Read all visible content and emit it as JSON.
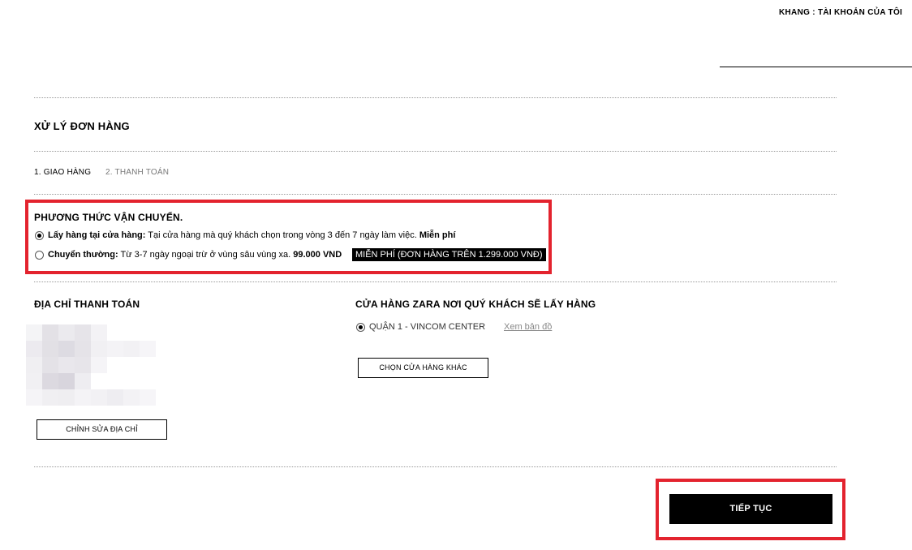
{
  "header": {
    "account_link": "KHANG : TÀI KHOẢN CỦA TÔI"
  },
  "page": {
    "title": "XỬ LÝ ĐƠN HÀNG"
  },
  "steps": [
    {
      "label": "1. GIAO HÀNG",
      "active": true
    },
    {
      "label": "2. THANH TOÁN",
      "active": false
    }
  ],
  "shipping": {
    "title": "PHƯƠNG THỨC VẬN CHUYỂN.",
    "options": [
      {
        "name": "Lấy hàng tại cửa hàng:",
        "description": " Tại cửa hàng mà quý khách chọn trong vòng 3 đến 7 ngày làm việc. ",
        "price": "Miễn phí",
        "selected": true
      },
      {
        "name": "Chuyển thường:",
        "description": " Từ 3-7 ngày ngoại trừ ở vùng sâu vùng xa. ",
        "price": "99.000 VND",
        "selected": false,
        "badge": "MIỄN PHÍ (ĐƠN HÀNG TRÊN 1.299.000 VNĐ)"
      }
    ]
  },
  "billing": {
    "title": "ĐỊA CHỈ THANH TOÁN",
    "edit_button": "CHỈNH SỬA ĐỊA CHỈ"
  },
  "store": {
    "title": "CỬA HÀNG ZARA NƠI QUÝ KHÁCH SẼ LẤY HÀNG",
    "selected_store": "QUẬN 1 - VINCOM CENTER",
    "map_link": "Xem bản đồ",
    "other_store_button": "CHỌN CỬA HÀNG KHÁC"
  },
  "actions": {
    "continue_button": "TIẾP TỤC"
  },
  "colors": {
    "highlight": "#e3232e",
    "button_bg": "#000000"
  }
}
